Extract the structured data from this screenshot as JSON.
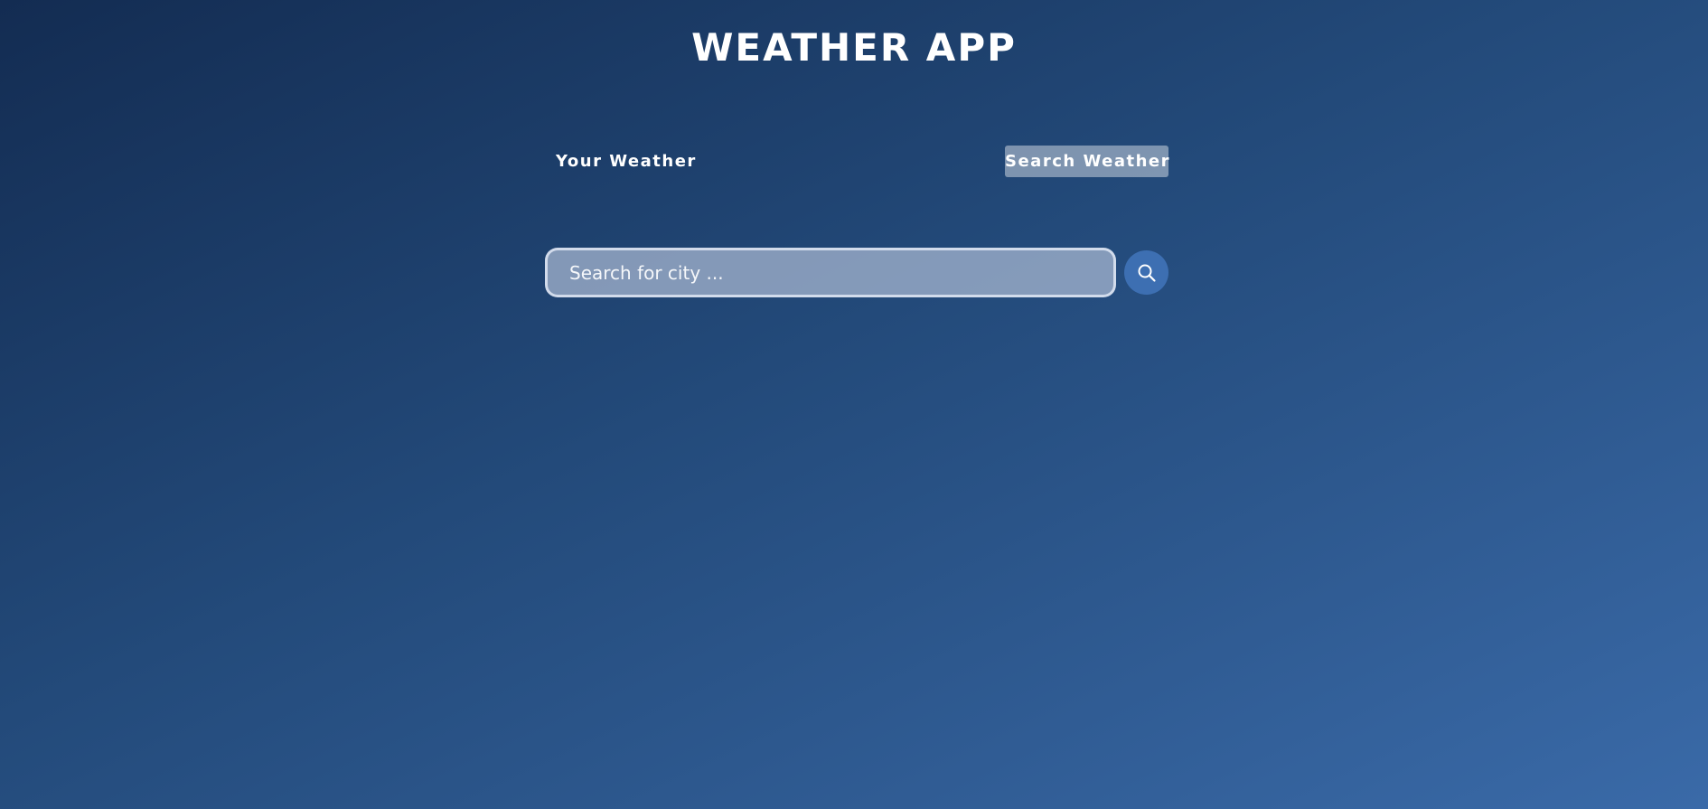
{
  "app": {
    "title": "WEATHER APP"
  },
  "tabs": [
    {
      "label": "Your Weather",
      "active": false
    },
    {
      "label": "Search Weather",
      "active": true
    }
  ],
  "search": {
    "placeholder": "Search for city ...",
    "value": "",
    "button_icon": "search-icon"
  },
  "colors": {
    "background_start": "#132c52",
    "background_end": "#3a6aa8",
    "search_button": "#3d6fb2",
    "text": "#ffffff"
  }
}
